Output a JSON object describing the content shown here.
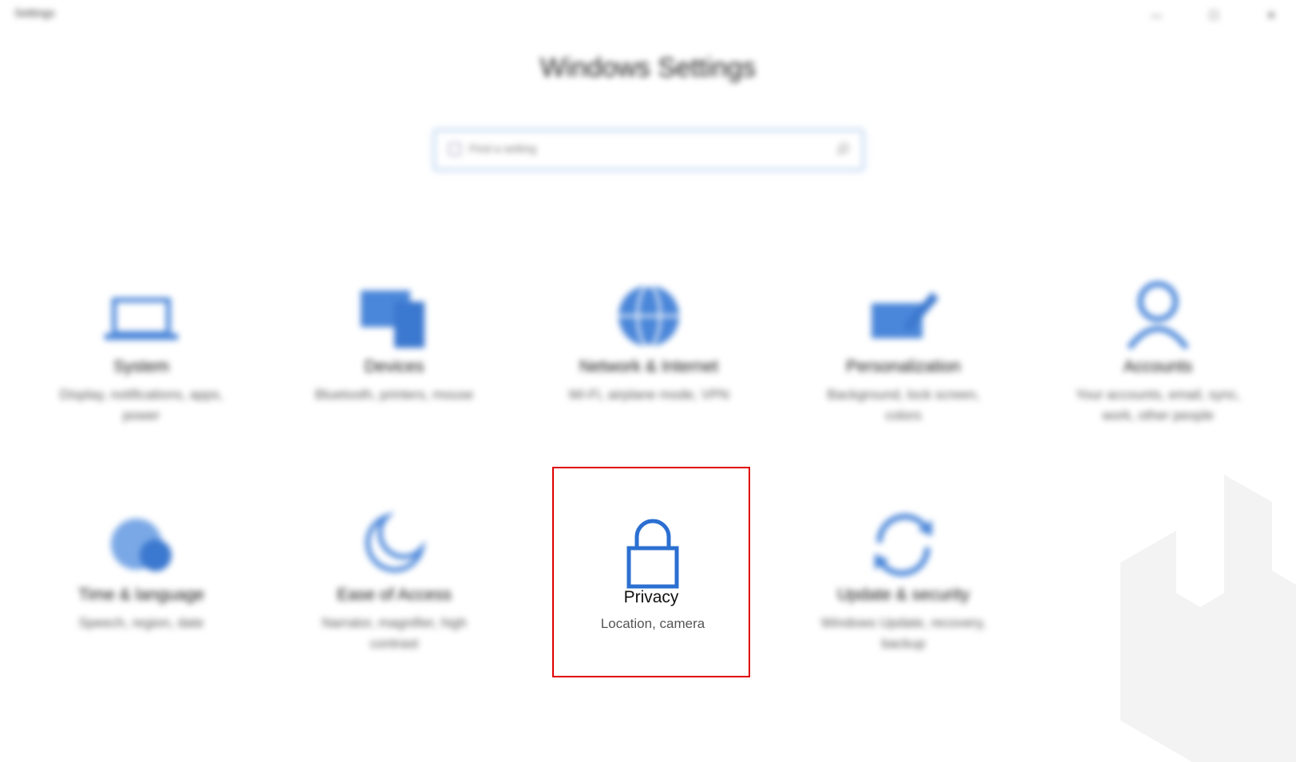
{
  "window": {
    "app_title": "Settings",
    "minimize_glyph": "—",
    "maximize_glyph": "☐",
    "close_glyph": "✕"
  },
  "page": {
    "title": "Windows Settings"
  },
  "search": {
    "placeholder": "Find a setting"
  },
  "tiles": [
    {
      "label": "System",
      "desc": "Display, notifications, apps, power",
      "icon": "laptop-icon"
    },
    {
      "label": "Devices",
      "desc": "Bluetooth, printers, mouse",
      "icon": "devices-icon"
    },
    {
      "label": "Network & Internet",
      "desc": "Wi-Fi, airplane mode, VPN",
      "icon": "globe-icon"
    },
    {
      "label": "Personalization",
      "desc": "Background, lock screen, colors",
      "icon": "paintbrush-icon"
    },
    {
      "label": "Accounts",
      "desc": "Your accounts, email, sync, work, other people",
      "icon": "person-icon"
    },
    {
      "label": "Time & language",
      "desc": "Speech, region, date",
      "icon": "time-language-icon"
    },
    {
      "label": "Ease of Access",
      "desc": "Narrator, magnifier, high contrast",
      "icon": "ease-of-access-icon"
    },
    {
      "label": "Privacy",
      "desc": "Location, camera",
      "icon": "lock-icon"
    },
    {
      "label": "Update & security",
      "desc": "Windows Update, recovery, backup",
      "icon": "sync-icon"
    }
  ],
  "colors": {
    "accent": "#2b6fd1",
    "highlight_border": "#e00000",
    "icon_blur": "#4a86d9"
  }
}
